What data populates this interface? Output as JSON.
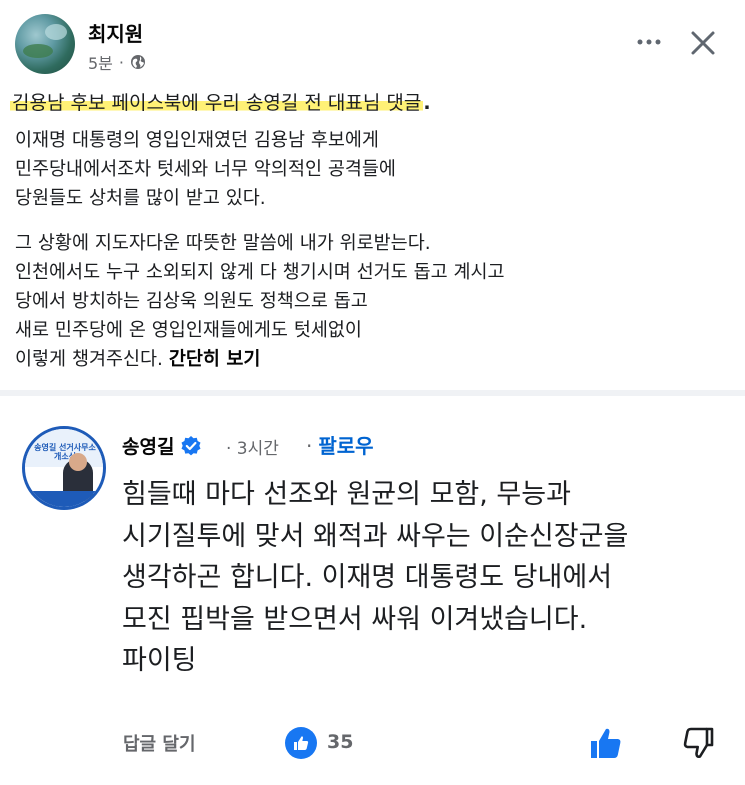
{
  "post": {
    "author": "최지원",
    "time": "5분",
    "separator": "·",
    "highlight": "김용남 후보 페이스북에 우리 송영길 전 대표님 댓글",
    "highlight_period": ".",
    "para1": [
      "이재명 대통령의 영입인재였던 김용남 후보에게",
      "민주당내에서조차 텃세와 너무 악의적인 공격들에",
      "당원들도 상처를 많이 받고 있다."
    ],
    "para2": [
      "그 상황에 지도자다운 따뜻한 말씀에 내가 위로받는다.",
      "인천에서도 누구 소외되지 않게 다 챙기시며 선거도 돕고 계시고",
      "당에서 방치하는 김상욱 의원도 정책으로 돕고",
      "새로 민주당에 온 영입인재들에게도 텃세없이"
    ],
    "para2_last": "이렇게 챙겨주신다.",
    "see_more": "간단히 보기"
  },
  "comment": {
    "author": "송영길",
    "time": "· 3시간",
    "follow_dot": "·",
    "follow": "팔로우",
    "lines": [
      "힘들때 마다 선조와 원균의 모함, 무능과",
      "시기질투에 맞서 왜적과 싸우는 이순신장군을",
      "생각하곤 합니다. 이재명 대통령도 당내에서",
      "모진 핍박을 받으면서 싸워 이겨냈습니다.",
      "파이팅"
    ],
    "reply": "답글 달기",
    "like_count": "35",
    "avatar_text": "송영길 선거사무소 개소식"
  },
  "colors": {
    "accent": "#1877f2",
    "follow": "#0064d1",
    "muted": "#65676b",
    "highlight": "#fff176"
  },
  "icons": [
    "globe-icon",
    "more-icon",
    "close-icon",
    "verified-icon",
    "like-reaction-icon",
    "thumb-up-icon",
    "thumb-down-icon"
  ]
}
